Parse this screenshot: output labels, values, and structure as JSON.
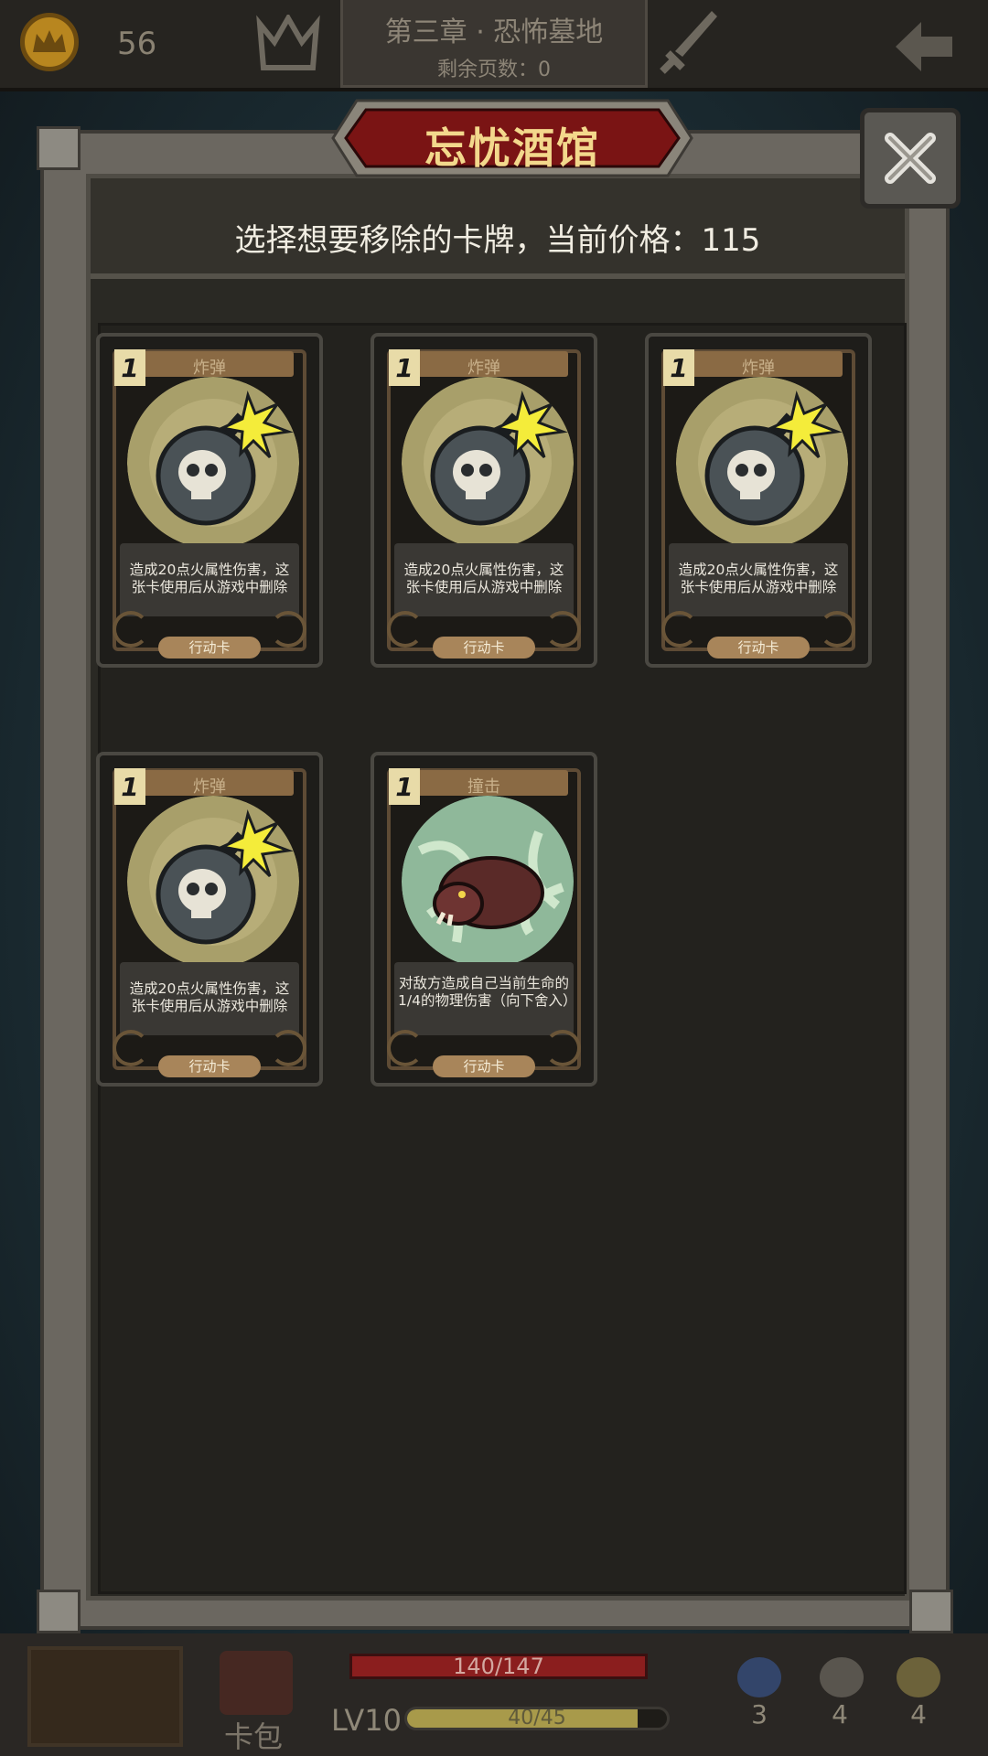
{
  "topbar": {
    "coins": "56",
    "chapter_title": "第三章 · 恐怖墓地",
    "pages_left": "剩余页数：0"
  },
  "modal": {
    "title": "忘忧酒馆",
    "prompt": "选择想要移除的卡牌，当前价格：115",
    "close_icon": "close-icon"
  },
  "cards": [
    {
      "cost": "1",
      "name": "炸弹",
      "desc": "造成20点火属性伤害，这张卡使用后从游戏中删除",
      "type": "行动卡",
      "art": "bomb-skull"
    },
    {
      "cost": "1",
      "name": "炸弹",
      "desc": "造成20点火属性伤害，这张卡使用后从游戏中删除",
      "type": "行动卡",
      "art": "bomb-skull"
    },
    {
      "cost": "1",
      "name": "炸弹",
      "desc": "造成20点火属性伤害，这张卡使用后从游戏中删除",
      "type": "行动卡",
      "art": "bomb-skull"
    },
    {
      "cost": "1",
      "name": "炸弹",
      "desc": "造成20点火属性伤害，这张卡使用后从游戏中删除",
      "type": "行动卡",
      "art": "bomb-skull"
    },
    {
      "cost": "1",
      "name": "撞击",
      "desc": "对敌方造成自己当前生命的1/4的物理伤害（向下舍入）",
      "type": "行动卡",
      "art": "charging-boar"
    }
  ],
  "bottombar": {
    "hp": "140/147",
    "hp_fraction": 0.952,
    "level": "LV10",
    "xp": "40/45",
    "xp_fraction": 0.889,
    "bag_label": "卡包",
    "potions": "3",
    "hourglass": "4",
    "cards": "4"
  },
  "colors": {
    "accent_gold": "#f3d88c",
    "hp_red": "#8b1e1e",
    "banner_red": "#7a1414"
  }
}
